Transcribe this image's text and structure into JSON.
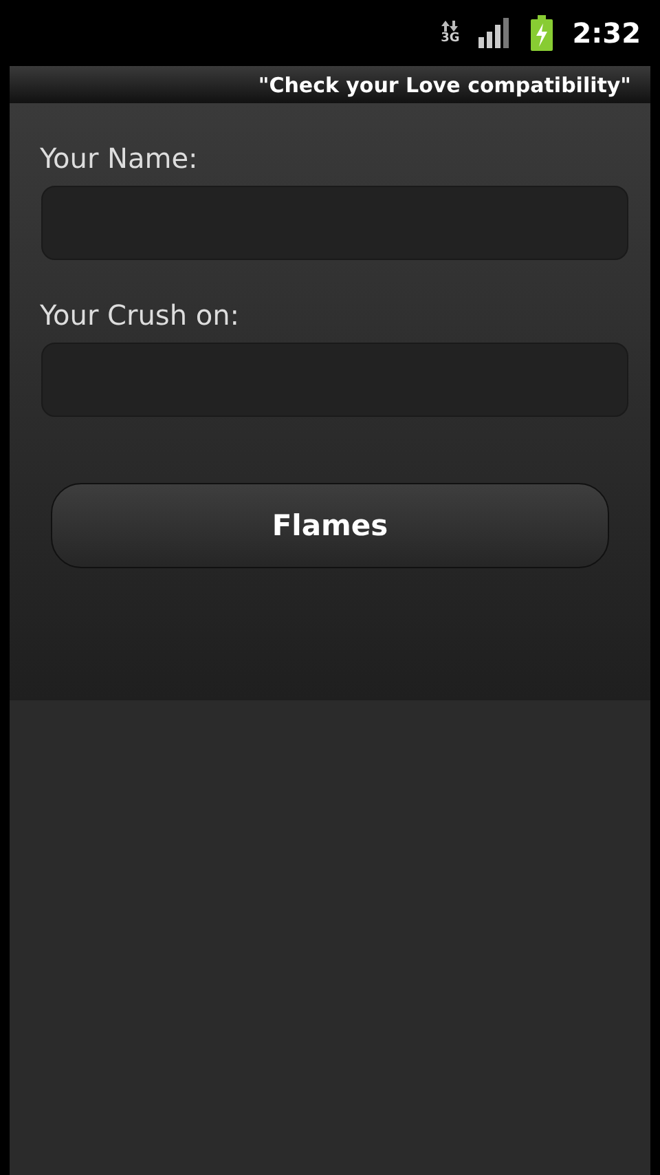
{
  "status_bar": {
    "network": "3G",
    "time": "2:32"
  },
  "title_bar": {
    "title": "\"Check your Love compatibility\""
  },
  "form": {
    "fields": [
      {
        "label": "Your Name:"
      },
      {
        "label": "Your Crush on:"
      }
    ],
    "button": "Flames"
  }
}
